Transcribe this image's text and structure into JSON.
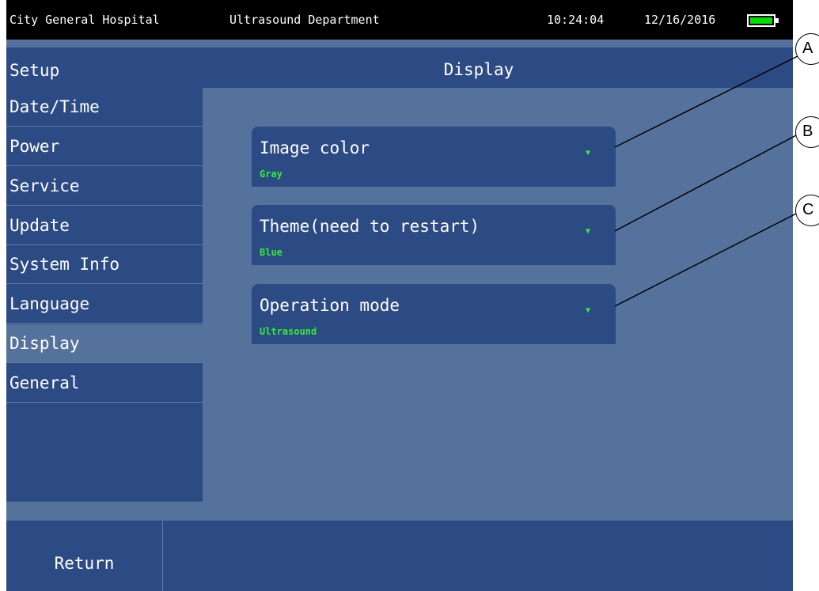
{
  "status": {
    "hospital": "City General Hospital",
    "department": "Ultrasound Department",
    "time": "10:24:04",
    "date": "12/16/2016",
    "battery_icon": "battery-full-icon",
    "battery_color": "#00e000"
  },
  "header": {
    "section": "Setup",
    "title": "Display"
  },
  "sidebar": {
    "items": [
      {
        "label": "Date/Time"
      },
      {
        "label": "Power"
      },
      {
        "label": "Service"
      },
      {
        "label": "Update"
      },
      {
        "label": "System Info"
      },
      {
        "label": "Language"
      },
      {
        "label": "Display",
        "active": true
      },
      {
        "label": "General"
      }
    ]
  },
  "settings": [
    {
      "label": "Image color",
      "value": "Gray"
    },
    {
      "label": "Theme(need to restart)",
      "value": "Blue"
    },
    {
      "label": "Operation mode",
      "value": "Ultrasound"
    }
  ],
  "footer": {
    "return_label": "Return"
  },
  "callouts": [
    "A",
    "B",
    "C"
  ],
  "colors": {
    "screen_bg": "#55729d",
    "panel": "#2c4a84",
    "value_text": "#33ee33"
  }
}
